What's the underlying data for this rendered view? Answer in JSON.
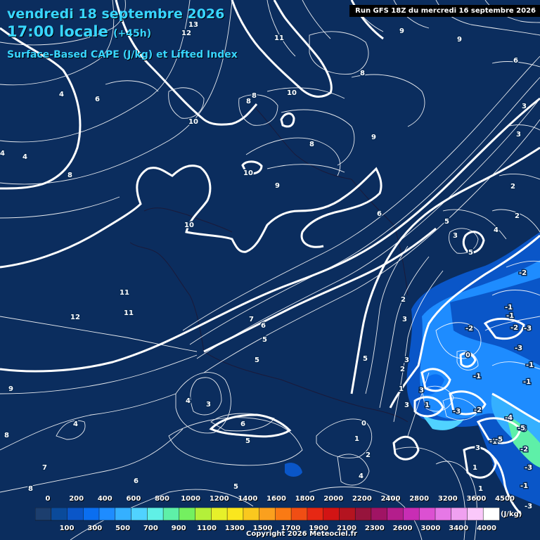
{
  "header": {
    "date_line": "vendredi 18 septembre 2026",
    "time_line": "17:00 locale",
    "offset": "(+45h)",
    "subtitle": "Surface-Based CAPE (J/kg) et Lifted Index",
    "run_info": "Run GFS 18Z du mercredi 16 septembre 2026"
  },
  "legend": {
    "top_labels": [
      "0",
      "200",
      "400",
      "600",
      "800",
      "1000",
      "1200",
      "1400",
      "1600",
      "1800",
      "2000",
      "2200",
      "2400",
      "2800",
      "3200",
      "3600",
      "4500"
    ],
    "bottom_labels": [
      "100",
      "300",
      "500",
      "700",
      "900",
      "1100",
      "1300",
      "1500",
      "1700",
      "1900",
      "2100",
      "2300",
      "2600",
      "3000",
      "3400",
      "4000"
    ],
    "unit": "(J/kg)",
    "colors": [
      "#1c3e6e",
      "#0a4a9a",
      "#0a56c8",
      "#0a6ef0",
      "#1e8cff",
      "#35b0ff",
      "#50d2ff",
      "#60f0e6",
      "#5ef0a8",
      "#74f060",
      "#b4f03a",
      "#e6f02a",
      "#fae61e",
      "#fac81e",
      "#faa01e",
      "#fa7a14",
      "#f04e14",
      "#e62814",
      "#d21414",
      "#b41420",
      "#96143c",
      "#a01464",
      "#b41e8c",
      "#c82db4",
      "#dc50d2",
      "#e678e6",
      "#f0a0f0",
      "#fac8fa",
      "#ffffff"
    ]
  },
  "map": {
    "colors": {
      "background": "#0b2d5e",
      "cape_low": "#0a56c8",
      "cape_mid": "#1e8cff",
      "cape_high": "#50d2ff",
      "cape_peak": "#5ef0a8",
      "contour": "#ffffff"
    },
    "contour_labels": [
      "13",
      "12",
      "11",
      "9",
      "9",
      "6",
      "8",
      "8",
      "4",
      "6",
      "10",
      "10",
      "10",
      "8",
      "9",
      "8",
      "3",
      "4",
      "8",
      "10",
      "9",
      "11",
      "11",
      "12",
      "7",
      "6",
      "5",
      "5",
      "4",
      "3",
      "4",
      "6",
      "5",
      "5",
      "8",
      "9",
      "7",
      "6",
      "8",
      "5",
      "0",
      "1",
      "4",
      "3",
      "2",
      "3",
      "2",
      "1",
      "3",
      "2",
      "1",
      "3",
      "-3",
      "-1",
      "0",
      "-1",
      "-2",
      "-3",
      "-2",
      "-1",
      "-1",
      "-2",
      "-3",
      "-1",
      "-2",
      "-1",
      "-3",
      "-4",
      "-5",
      "-5",
      "-2",
      "-3",
      "-1",
      "-5",
      "3",
      "4",
      "5",
      "5",
      "1",
      "1",
      "3",
      "6",
      "2",
      "3",
      "4",
      "2"
    ]
  },
  "footer": {
    "copyright": "Copyright 2026 Meteociel.fr",
    "corner_values": [
      "-3",
      "-5",
      "0"
    ]
  }
}
